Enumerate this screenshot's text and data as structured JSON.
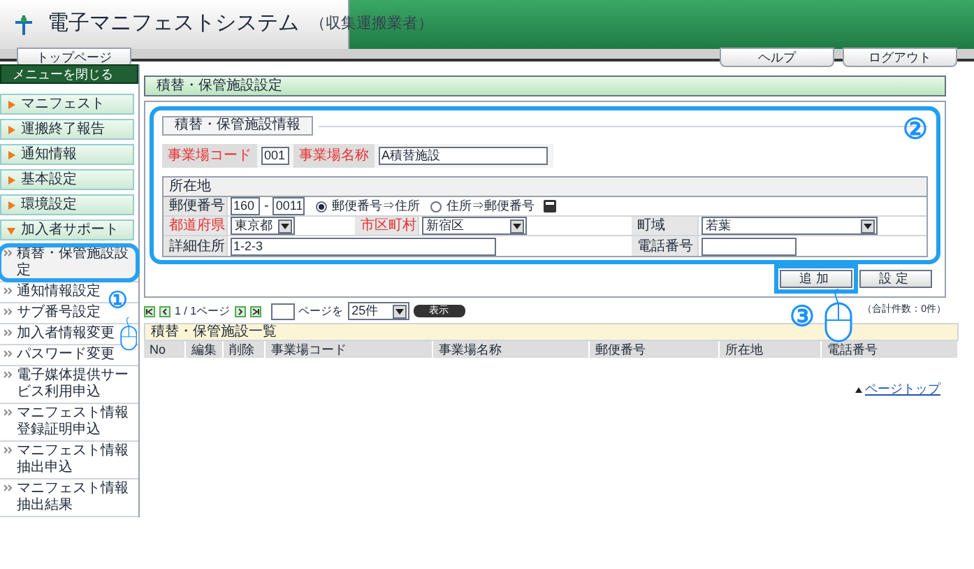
{
  "header": {
    "title": "電子マニフェストシステム",
    "subtitle": "（収集運搬業者）"
  },
  "nav": {
    "left": [
      "トップページ"
    ],
    "right": [
      "ヘルプ",
      "ログアウト"
    ]
  },
  "sidebar": {
    "close_button": "メニューを閉じる",
    "categories": [
      {
        "label": "マニフェスト",
        "expanded": false
      },
      {
        "label": "運搬終了報告",
        "expanded": false
      },
      {
        "label": "通知情報",
        "expanded": false
      },
      {
        "label": "基本設定",
        "expanded": false
      },
      {
        "label": "環境設定",
        "expanded": false
      },
      {
        "label": "加入者サポート",
        "expanded": true,
        "children": [
          {
            "label": "積替・保管施設設定",
            "selected": true
          },
          {
            "label": "通知情報設定",
            "selected": false
          },
          {
            "label": "サブ番号設定",
            "selected": false
          },
          {
            "label": "加入者情報変更",
            "selected": false
          },
          {
            "label": "パスワード変更",
            "selected": false
          },
          {
            "label": "電子媒体提供サービス利用申込",
            "selected": false
          },
          {
            "label": "マニフェスト情報登録証明申込",
            "selected": false
          },
          {
            "label": "マニフェスト情報抽出申込",
            "selected": false
          },
          {
            "label": "マニフェスト情報抽出結果",
            "selected": false
          }
        ]
      }
    ]
  },
  "page_title": "積替・保管施設設定",
  "form": {
    "legend": "積替・保管施設情報",
    "code_label": "事業場コード",
    "code_value": "001",
    "name_label": "事業場名称",
    "name_value": "A積替施設",
    "location_header": "所在地",
    "postal_label": "郵便番号",
    "postal_1": "160",
    "postal_sep": "-",
    "postal_2": "0011",
    "radios": [
      {
        "label": "郵便番号⇒住所",
        "selected": true
      },
      {
        "label": "住所⇒郵便番号",
        "selected": false
      }
    ],
    "pref_label": "都道府県",
    "pref_value": "東京都",
    "city_label": "市区町村",
    "city_value": "新宿区",
    "town_label": "町域",
    "town_value": "若葉",
    "address_label": "詳細住所",
    "address_value": "1-2-3",
    "phone_label": "電話番号"
  },
  "buttons": [
    "追加",
    "設定"
  ],
  "pager": {
    "text": "1 / 1ページ",
    "suffix": "ページを",
    "per_page": "25件",
    "show_button": "表示",
    "total": "（合計件数：0件）"
  },
  "list": {
    "title": "積替・保管施設一覧",
    "columns": [
      "No",
      "編集",
      "削除",
      "事業場コード",
      "事業場名称",
      "郵便番号",
      "所在地",
      "電話番号"
    ]
  },
  "page_top": "ページトップ",
  "callouts": [
    "①",
    "②",
    "③"
  ]
}
